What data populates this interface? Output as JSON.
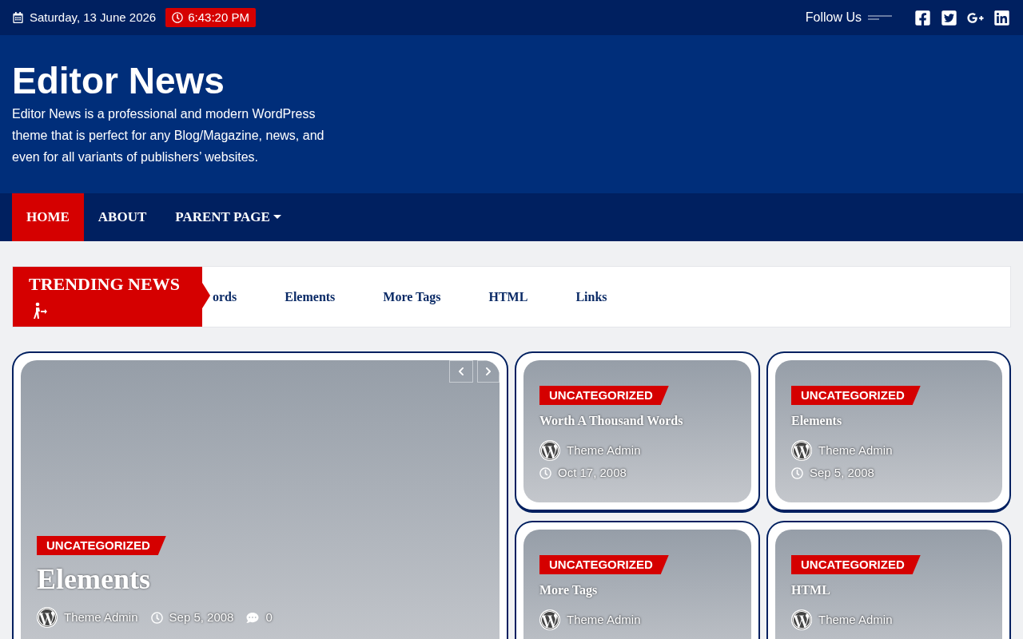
{
  "top_bar": {
    "date": "Saturday, 13 June 2026",
    "time": "6:43:20 PM",
    "follow_label": "Follow Us",
    "social": [
      {
        "kind": "facebook"
      },
      {
        "kind": "twitter"
      },
      {
        "kind": "google-plus"
      },
      {
        "kind": "linkedin"
      }
    ]
  },
  "site": {
    "title": "Editor News",
    "description": "Editor News is a professional and modern WordPress theme that is perfect for any Blog/Magazine, news, and even for all variants of publishers’ websites."
  },
  "nav": [
    {
      "label": "HOME",
      "selected": true,
      "has_dropdown": false
    },
    {
      "label": "ABOUT",
      "selected": false,
      "has_dropdown": false
    },
    {
      "label": "PARENT PAGE",
      "selected": false,
      "has_dropdown": true
    }
  ],
  "ticker": {
    "label": "TRENDING NEWS",
    "items": [
      "ords",
      "Elements",
      "More Tags",
      "HTML",
      "Links"
    ]
  },
  "featured": {
    "category": "UNCATEGORIZED",
    "title": "Elements",
    "author": "Theme Admin",
    "date": "Sep 5, 2008",
    "comments": "0"
  },
  "posts": [
    {
      "category": "UNCATEGORIZED",
      "title": "Worth A Thousand Words",
      "author": "Theme Admin",
      "date": "Oct 17, 2008"
    },
    {
      "category": "UNCATEGORIZED",
      "title": "Elements",
      "author": "Theme Admin",
      "date": "Sep 5, 2008"
    },
    {
      "category": "UNCATEGORIZED",
      "title": "More Tags",
      "author": "Theme Admin"
    },
    {
      "category": "UNCATEGORIZED",
      "title": "HTML",
      "author": "Theme Admin"
    }
  ]
}
